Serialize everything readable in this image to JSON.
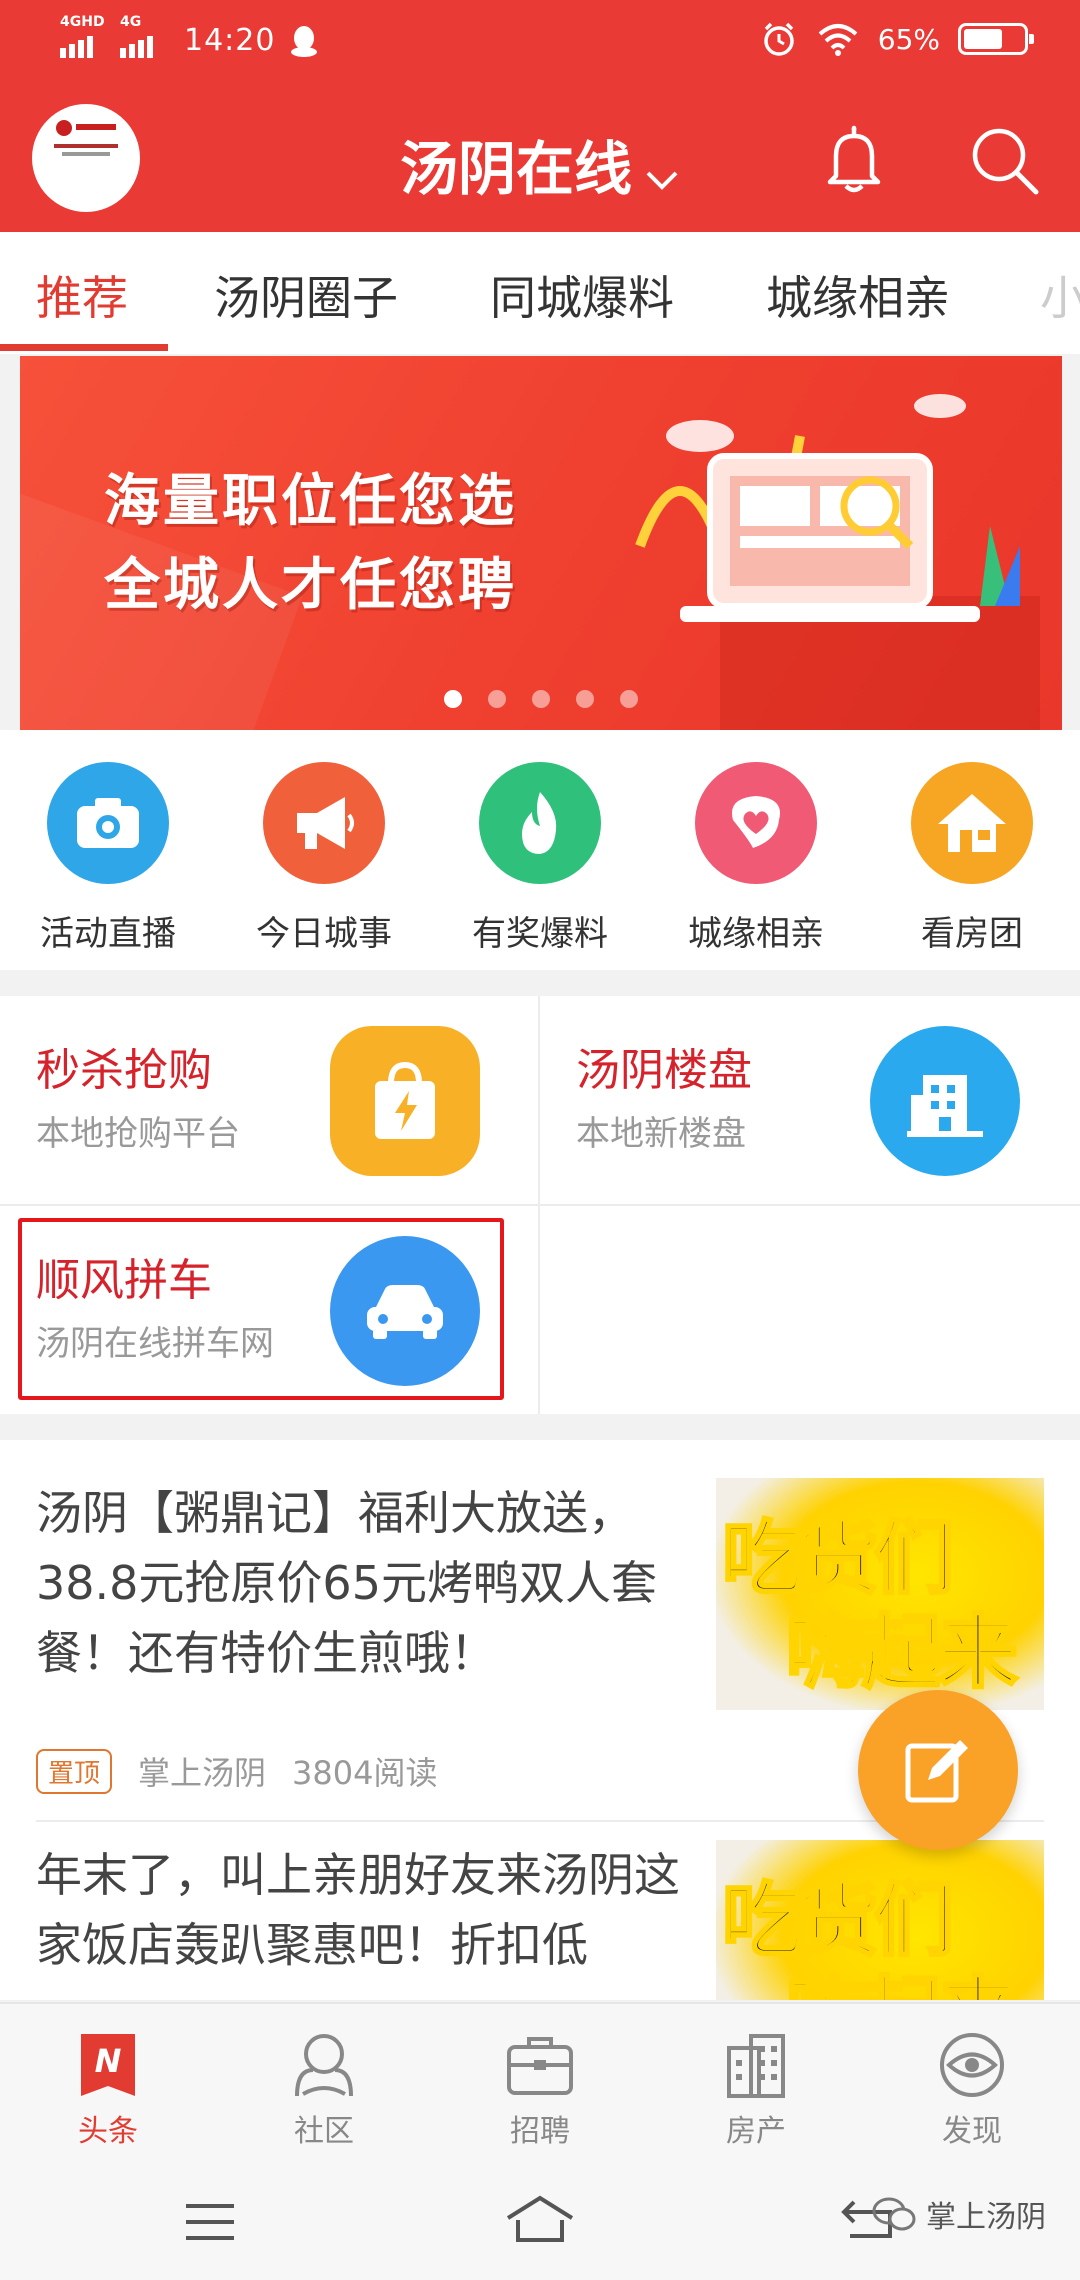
{
  "status_bar": {
    "sim1_network": "4GHD",
    "sim2_network": "4G",
    "time": "14:20",
    "battery_text": "65%",
    "battery_level": 0.65
  },
  "header": {
    "logo_text": "汤阴在线",
    "title": "汤阴在线",
    "bell_icon": "bell-icon",
    "search_icon": "search-icon"
  },
  "tabs": [
    {
      "label": "推荐",
      "active": true
    },
    {
      "label": "汤阴圈子"
    },
    {
      "label": "同城爆料"
    },
    {
      "label": "城缘相亲"
    },
    {
      "label": "小"
    }
  ],
  "banner": {
    "line1": "海量职位任您选",
    "line2": "全城人才任您聘",
    "slides": 5,
    "active_slide": 1
  },
  "quick_links": [
    {
      "label": "活动直播",
      "icon": "camera-icon",
      "color": "#2fa6e8"
    },
    {
      "label": "今日城事",
      "icon": "megaphone-icon",
      "color": "#f0613b"
    },
    {
      "label": "有奖爆料",
      "icon": "flame-icon",
      "color": "#2fc07c"
    },
    {
      "label": "城缘相亲",
      "icon": "heart-icon",
      "color": "#f05a74"
    },
    {
      "label": "看房团",
      "icon": "house-icon",
      "color": "#f7a623"
    }
  ],
  "services": [
    {
      "title": "秒杀抢购",
      "subtitle": "本地抢购平台",
      "icon": "shopping-bag-icon",
      "color": "#f8b126"
    },
    {
      "title": "汤阴楼盘",
      "subtitle": "本地新楼盘",
      "icon": "building-icon",
      "color": "#2aa9ee"
    },
    {
      "title": "顺风拼车",
      "subtitle": "汤阴在线拼车网",
      "icon": "car-icon",
      "color": "#3a98f0"
    }
  ],
  "articles": [
    {
      "title": "汤阴【粥鼎记】福利大放送，38.8元抢原价65元烤鸭双人套餐！还有特价生煎哦！",
      "pin": "置顶",
      "source": "掌上汤阴",
      "reads": "3804阅读",
      "thumb_line1": "吃货们",
      "thumb_line2": "嗨起来"
    },
    {
      "title": "年末了，叫上亲朋好友来汤阴这家饭店轰趴聚惠吧！折扣低",
      "thumb_line1": "吃货们",
      "thumb_line2": "嗨起来"
    }
  ],
  "bottom_nav": [
    {
      "label": "头条",
      "icon": "news-icon",
      "active": true
    },
    {
      "label": "社区",
      "icon": "community-icon"
    },
    {
      "label": "招聘",
      "icon": "briefcase-icon"
    },
    {
      "label": "房产",
      "icon": "buildings-icon"
    },
    {
      "label": "发现",
      "icon": "eye-icon"
    }
  ],
  "watermark": "掌上汤阴",
  "colors": {
    "brand_red": "#ea3a35",
    "accent_red": "#e23b32",
    "highlight_border": "#e5171b",
    "fab_orange": "#f9a227"
  }
}
